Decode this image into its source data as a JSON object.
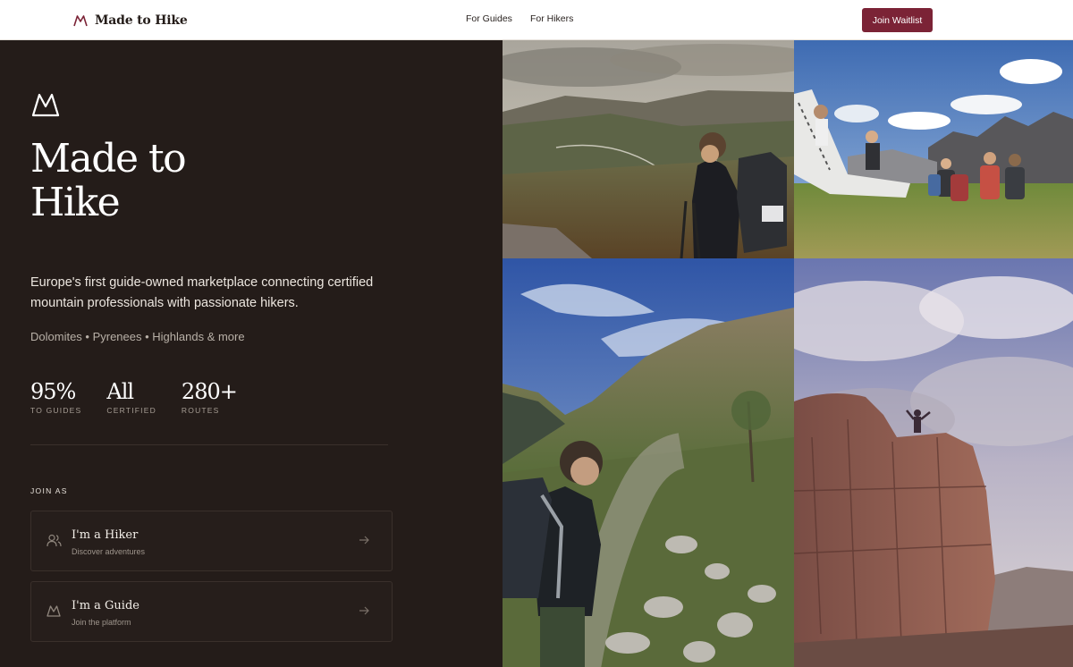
{
  "nav": {
    "brand": "Made to Hike",
    "links": [
      "For Guides",
      "For Hikers"
    ],
    "cta": "Join Waitlist"
  },
  "hero": {
    "title_line1": "Made to",
    "title_line2": "Hike",
    "description": "Europe's first guide-owned marketplace connecting certified mountain professionals with passionate hikers.",
    "regions": "Dolomites • Pyrenees • Highlands & more"
  },
  "stats": [
    {
      "value": "95%",
      "label": "TO GUIDES"
    },
    {
      "value": "All",
      "label": "CERTIFIED"
    },
    {
      "value": "280+",
      "label": "ROUTES"
    }
  ],
  "join": {
    "heading": "JOIN AS",
    "options": [
      {
        "title": "I'm a Hiker",
        "subtitle": "Discover adventures",
        "icon": "users-icon"
      },
      {
        "title": "I'm a Guide",
        "subtitle": "Join the platform",
        "icon": "mountain-icon"
      }
    ]
  },
  "colors": {
    "panel_bg": "#241c19",
    "accent": "#7b2336",
    "text_light": "#f3efe9",
    "text_muted": "#a69d94"
  },
  "photos": [
    "hiker-valley-photo",
    "group-picnic-photo",
    "hiker-glen-photo",
    "climber-summit-photo"
  ]
}
